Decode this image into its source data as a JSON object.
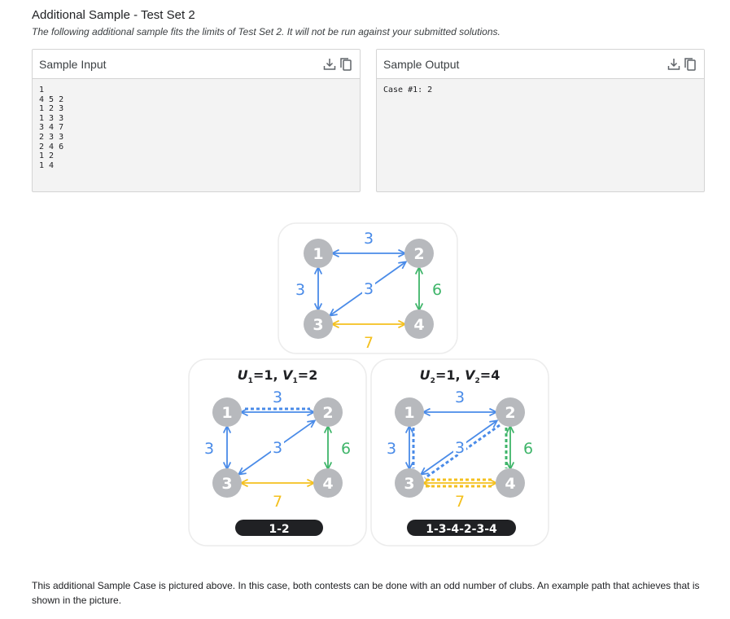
{
  "header": {
    "title": "Additional Sample - Test Set 2",
    "subtitle": "The following additional sample fits the limits of Test Set 2. It will not be run against your submitted solutions."
  },
  "sample_input": {
    "label": "Sample Input",
    "content": "1\n4 5 2\n1 2 3\n1 3 3\n3 4 7\n2 3 3\n2 4 6\n1 2\n1 4"
  },
  "sample_output": {
    "label": "Sample Output",
    "content": "Case #1: 2"
  },
  "figure": {
    "top_graph": {
      "nodes": [
        "1",
        "2",
        "3",
        "4"
      ],
      "weights": {
        "w12": "3",
        "w13": "3",
        "w23": "3",
        "w24": "6",
        "w34": "7"
      }
    },
    "left_case": {
      "formula": {
        "u": "U",
        "u_sub": "1",
        "u_val": "=1, ",
        "v": "V",
        "v_sub": "1",
        "v_val": "=2"
      },
      "path": "1-2"
    },
    "right_case": {
      "formula": {
        "u": "U",
        "u_sub": "2",
        "u_val": "=1, ",
        "v": "V",
        "v_sub": "2",
        "v_val": "=4"
      },
      "path": "1-3-4-2-3-4"
    },
    "colors": {
      "node": "#b7b9bd",
      "blue": "#4a8be8",
      "green": "#3fb56a",
      "yellow": "#f4c01e",
      "pill": "#202124"
    }
  },
  "footer": {
    "text": "This additional Sample Case is pictured above. In this case, both contests can be done with an odd number of clubs. An example path that achieves that is shown in the picture."
  }
}
